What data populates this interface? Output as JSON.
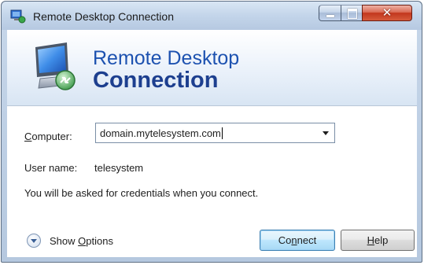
{
  "window": {
    "title": "Remote Desktop Connection",
    "close_glyph": "✕"
  },
  "banner": {
    "line1": "Remote Desktop",
    "line2": "Connection"
  },
  "form": {
    "computer_label_accel": "C",
    "computer_label_rest": "omputer:",
    "computer_value": "domain.mytelesystem.com",
    "username_label": "User name:",
    "username_value": "telesystem",
    "info_text": "You will be asked for credentials when you connect."
  },
  "footer": {
    "show_options_prefix": "Show ",
    "show_options_accel": "O",
    "show_options_rest": "ptions",
    "connect_prefix": "Co",
    "connect_accel": "n",
    "connect_rest": "nect",
    "help_accel": "H",
    "help_rest": "elp"
  },
  "colors": {
    "title_gradient": "#c3d5ea",
    "banner_blue": "#1d52b0",
    "close_red": "#c2361d",
    "connect_highlight": "#bee6fd"
  },
  "icons": [
    "remote-desktop-app-icon",
    "remote-desktop-monitor-icon",
    "show-options-chevron-icon",
    "combo-dropdown-arrow-icon"
  ]
}
